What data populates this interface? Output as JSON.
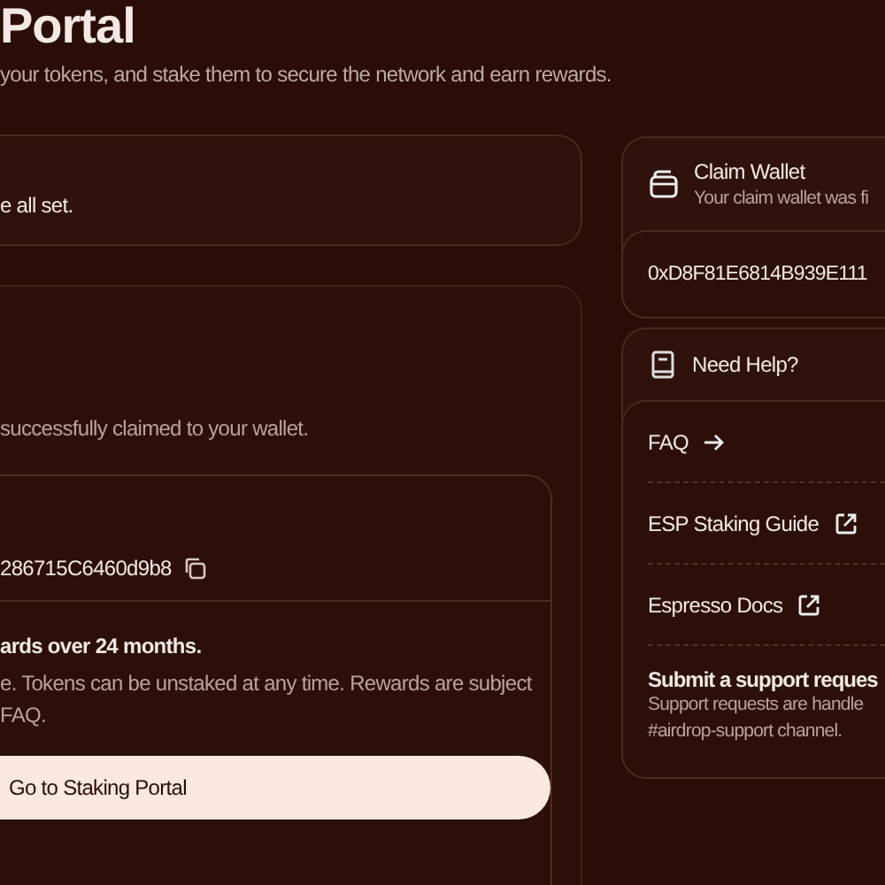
{
  "page": {
    "title": "Portal",
    "subtitle": "your tokens, and stake them to secure the network and earn rewards."
  },
  "status_card": {
    "text": "e all set."
  },
  "claim_card": {
    "text": "successfully claimed to your wallet.",
    "address": "286715C6460d9b8",
    "staking_heading": "ards over 24 months.",
    "staking_text": [
      "e. Tokens can be unstaked at any time. Rewards are subject",
      "FAQ."
    ],
    "button": "Go to Staking Portal"
  },
  "claim_wallet": {
    "title": "Claim Wallet",
    "subtitle": "Your claim wallet was fi",
    "address": "0xD8F81E6814B939E111"
  },
  "help": {
    "title": "Need Help?",
    "links": [
      {
        "label": "FAQ",
        "kind": "internal"
      },
      {
        "label": "ESP Staking Guide",
        "kind": "external"
      },
      {
        "label": "Espresso Docs",
        "kind": "external"
      }
    ],
    "support": {
      "title": "Submit a support reques",
      "text": [
        "Support requests are handle",
        "#airdrop-support channel."
      ]
    }
  }
}
